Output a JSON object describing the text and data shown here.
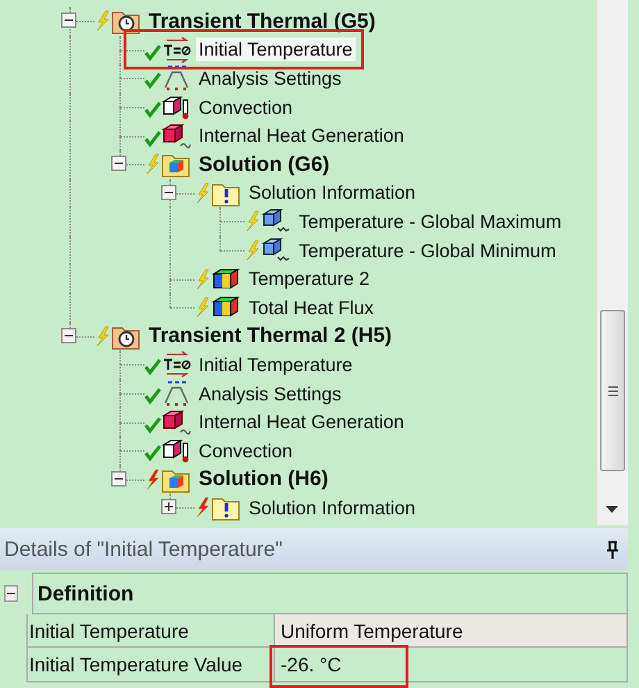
{
  "tree": [
    {
      "label": "Transient Thermal (G5)",
      "kind": "analysis",
      "solved": false,
      "failed": false,
      "bold": true,
      "expanded": true,
      "selected": false,
      "children": [
        {
          "label": "Initial Temperature",
          "kind": "init-temp",
          "solved": true,
          "bold": false,
          "selected": true,
          "highlighted": true
        },
        {
          "label": "Analysis Settings",
          "kind": "settings",
          "solved": true,
          "bold": false,
          "selected": false
        },
        {
          "label": "Convection",
          "kind": "convection",
          "solved": true,
          "bold": false,
          "selected": false
        },
        {
          "label": "Internal Heat Generation",
          "kind": "heat-gen",
          "solved": true,
          "bold": false,
          "selected": false
        },
        {
          "label": "Solution (G6)",
          "kind": "solution",
          "solved": false,
          "failed": false,
          "bold": true,
          "expanded": true,
          "selected": false,
          "children": [
            {
              "label": "Solution Information",
              "kind": "info",
              "solved": false,
              "failed": false,
              "bold": false,
              "expanded": true,
              "selected": false,
              "children": [
                {
                  "label": "Temperature - Global Maximum",
                  "kind": "probe",
                  "solved": false,
                  "failed": false,
                  "bold": false,
                  "selected": false
                },
                {
                  "label": "Temperature - Global Minimum",
                  "kind": "probe",
                  "solved": false,
                  "failed": false,
                  "bold": false,
                  "selected": false
                }
              ]
            },
            {
              "label": "Temperature 2",
              "kind": "result",
              "solved": false,
              "failed": false,
              "bold": false,
              "selected": false
            },
            {
              "label": "Total Heat Flux",
              "kind": "result",
              "solved": false,
              "failed": false,
              "bold": false,
              "selected": false
            }
          ]
        }
      ]
    },
    {
      "label": "Transient Thermal 2 (H5)",
      "kind": "analysis",
      "solved": false,
      "failed": false,
      "bold": true,
      "expanded": true,
      "selected": false,
      "children": [
        {
          "label": "Initial Temperature",
          "kind": "init-temp",
          "solved": true,
          "bold": false,
          "selected": false
        },
        {
          "label": "Analysis Settings",
          "kind": "settings",
          "solved": true,
          "bold": false,
          "selected": false
        },
        {
          "label": "Internal Heat Generation",
          "kind": "heat-gen",
          "solved": true,
          "bold": false,
          "selected": false
        },
        {
          "label": "Convection",
          "kind": "convection",
          "solved": true,
          "bold": false,
          "selected": false
        },
        {
          "label": "Solution (H6)",
          "kind": "solution",
          "solved": false,
          "failed": true,
          "bold": true,
          "expanded": true,
          "selected": false,
          "children": [
            {
              "label": "Solution Information",
              "kind": "info",
              "solved": false,
              "failed": true,
              "bold": false,
              "expanded": false,
              "selected": false
            }
          ]
        }
      ]
    }
  ],
  "details": {
    "title": "Details of \"Initial Temperature\"",
    "sections": [
      {
        "label": "Definition",
        "expanded": true,
        "rows": [
          {
            "name": "Initial Temperature",
            "value": "Uniform Temperature",
            "readonly": true
          },
          {
            "name": "Initial Temperature Value",
            "value": "-26. °C",
            "readonly": false,
            "highlighted": true
          }
        ]
      }
    ]
  }
}
